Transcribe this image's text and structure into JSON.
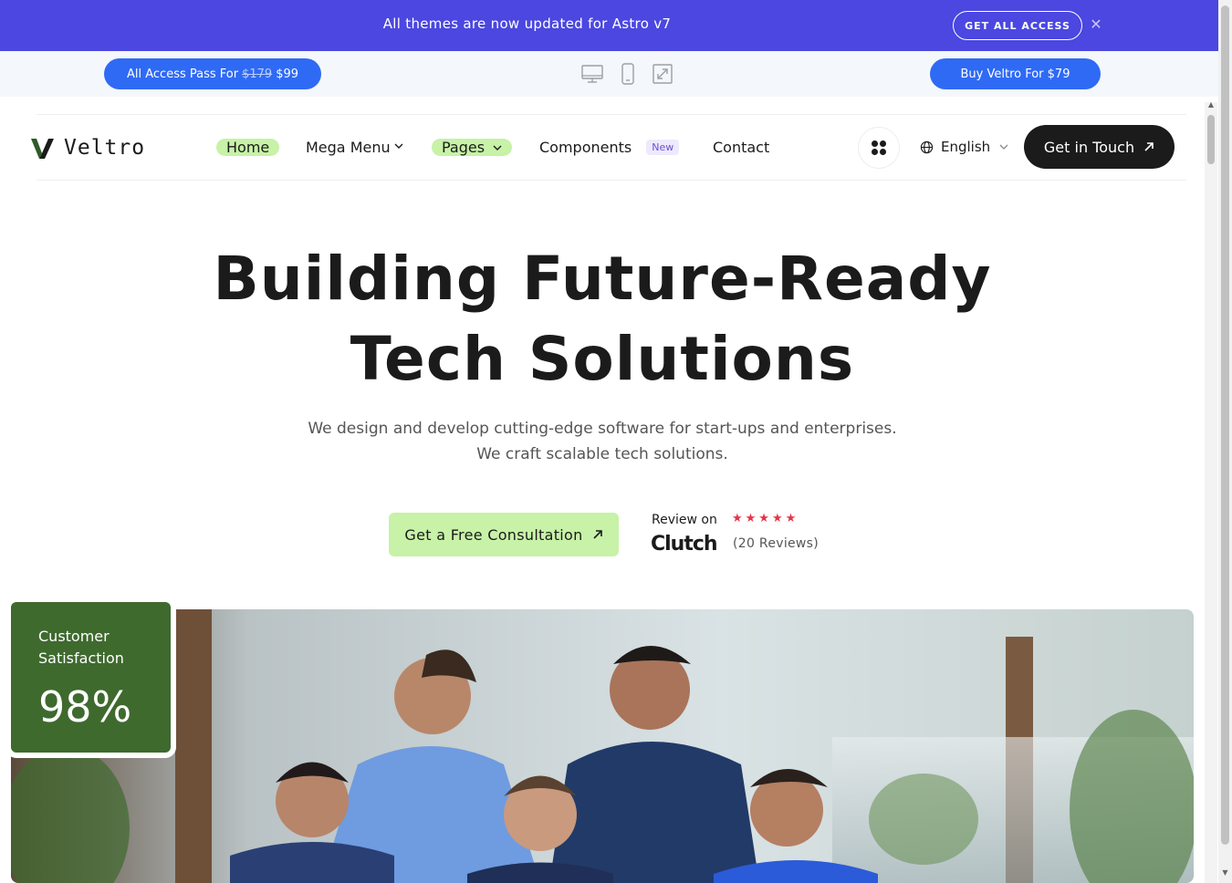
{
  "announcement": {
    "text": "All themes are now updated for Astro v7",
    "button_label": "GET ALL ACCESS",
    "close_glyph": "✕"
  },
  "demo_bar": {
    "left_button": {
      "prefix": "All Access Pass For",
      "old_price": "$179",
      "new_price": "$99"
    },
    "right_button": "Buy Veltro For $79",
    "devices": [
      "desktop-icon",
      "mobile-icon",
      "expand-icon"
    ]
  },
  "nav": {
    "logo_text": "Veltro",
    "items": [
      {
        "label": "Home",
        "highlighted": true
      },
      {
        "label": "Mega Menu",
        "dropdown": true
      },
      {
        "label": "Pages",
        "highlighted": true,
        "dropdown": true
      },
      {
        "label": "Components",
        "badge": "New"
      },
      {
        "label": "Contact"
      }
    ],
    "language": "English",
    "cta": "Get in Touch"
  },
  "hero": {
    "title_line1": "Building Future-Ready",
    "title_line2": "Tech Solutions",
    "subtitle": "We design and develop cutting-edge software for start-ups and enterprises. We craft scalable tech solutions.",
    "cta": "Get a Free Consultation",
    "review": {
      "label": "Review on",
      "platform": "Clutch",
      "stars": "★★★★★",
      "rating": 5,
      "count_text": "(20 Reviews)"
    }
  },
  "stat_card": {
    "label": "Customer Satisfaction",
    "value": "98%"
  },
  "colors": {
    "announcement_bg": "#4b47e0",
    "primary_blue": "#2f6af5",
    "lime_accent": "#c7f2a7",
    "dark": "#1b1b1b",
    "stat_green": "#3e6a2e",
    "star_red": "#e5344a"
  }
}
